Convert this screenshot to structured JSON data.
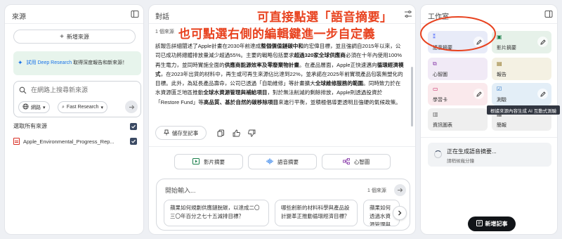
{
  "sources_panel": {
    "title": "來源",
    "add_button": "新增來源",
    "research_banner": {
      "link": "試用 Deep Research",
      "text": "取得深度報告和新來源！"
    },
    "search": {
      "placeholder": "在網路上搜尋新來源",
      "scope_chip": "網路",
      "mode_chip": "Fast Research"
    },
    "select_all_label": "選取所有來源",
    "items": [
      {
        "name": "Apple_Environmental_Progress_Rep...",
        "type": "pdf",
        "checked": true
      }
    ]
  },
  "chat_panel": {
    "title": "對話",
    "source_count": "1 個來源",
    "response_segments": [
      {
        "t": "該報告詳細闡述了Apple計畫在2030年前達成"
      },
      {
        "t": "整個價值鏈碳中和",
        "b": true
      },
      {
        "t": "的宏偉目標，並且強調自2015年以來，公司已成功將總體排放量減少超過55%。主要的戰略包括要求"
      },
      {
        "t": "超過320家全球供應商",
        "b": true
      },
      {
        "t": "必須在十年內使用100%再生電力，並同時實施全面的"
      },
      {
        "t": "供應商能源效率及零廢棄物計畫",
        "b": true
      },
      {
        "t": "。在產品層面，Apple正快速邁向"
      },
      {
        "t": "循環經濟模式",
        "b": true
      },
      {
        "t": "，在2023年出貨的材料中，再生或可再生來源佔比達到22%，並承諾在2025年前實現產品包裝無塑化的目標。此外，為延長產品壽命，公司已透過「自助維修」等計畫擴大"
      },
      {
        "t": "全球維修服務的範圍",
        "b": true
      },
      {
        "t": "。同時致力於在水資源匱乏地區推動"
      },
      {
        "t": "全球水資源管理與補給項目",
        "b": true
      },
      {
        "t": "，對於無法削減的剩餘排放，Apple則透過投資於「Restore Fund」等"
      },
      {
        "t": "高品質、基於自然的碳移除項目",
        "b": true
      },
      {
        "t": "來進行平衡，並積極倡導更透明且強硬的氣候政策。"
      }
    ],
    "save_note_button": "儲存至記事",
    "quick_actions": [
      "影片摘要",
      "語音摘要",
      "心智圖"
    ],
    "composer": {
      "placeholder": "開始輸入...",
      "source_count": "1 個來源",
      "suggestions": [
        "蘋果如何規劃供應鏈脫碳，以達成二〇三〇年百分之七十五減排目標？",
        "哪些創新的材料科學與產品設計變革正推動循環經濟目標？",
        "蘋果如何透過水資源管理與社區應商的環境正義？"
      ]
    }
  },
  "studio_panel": {
    "title": "工作室",
    "tiles": [
      {
        "label": "語音摘要",
        "icon": "audio-icon",
        "color": "#e8ebf8",
        "edit": true
      },
      {
        "label": "影片摘要",
        "icon": "video-icon",
        "color": "#e6f1e9",
        "edit": true
      },
      {
        "label": "心智圖",
        "icon": "mindmap-icon",
        "color": "#f1eaf6",
        "edit": false
      },
      {
        "label": "報告",
        "icon": "report-icon",
        "color": "#f4f1e3",
        "edit": false
      },
      {
        "label": "學習卡",
        "icon": "flashcard-icon",
        "color": "#fae9ec",
        "edit": true
      },
      {
        "label": "測驗",
        "icon": "quiz-icon",
        "color": "#e3eef7",
        "edit": true
      },
      {
        "label": "資訊圖表",
        "icon": "infographic-icon",
        "color": "#efefef",
        "edit": false
      },
      {
        "label": "簡報",
        "icon": "slides-icon",
        "color": "#efefef",
        "edit": false
      }
    ],
    "tooltip": "根據來源內容生成 AI 互動式測驗",
    "generating": {
      "title": "正在生成語音摘要...",
      "subtitle": "請稍候幾分鐘"
    },
    "add_note_button": "新增記事"
  },
  "annotation": {
    "line1": "可直接點選「語音摘要」",
    "line2": "也可點選右側的編輯鍵進一步自定義",
    "color": "#e8421f"
  }
}
